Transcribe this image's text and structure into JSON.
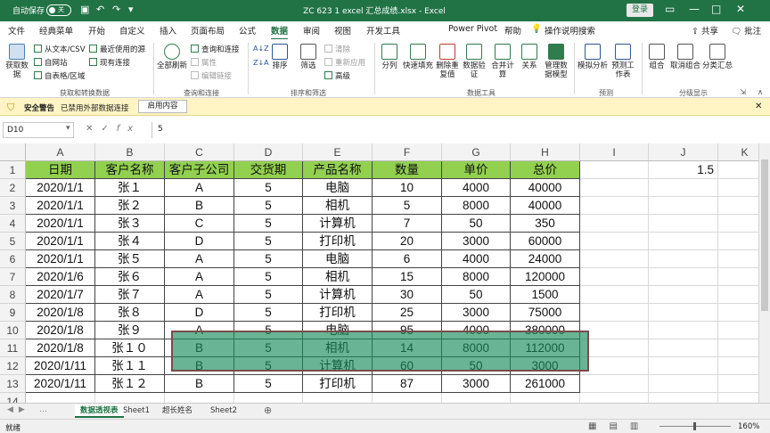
{
  "titlebar": {
    "autosave": "自动保存",
    "toggle": "关",
    "title": "ZC 623 1 excel 汇总成绩.xlsx  -  Excel",
    "login": "登录"
  },
  "tabs": [
    "文件",
    "经典菜单",
    "开始",
    "自定义",
    "插入",
    "页面布局",
    "公式",
    "数据",
    "审阅",
    "视图",
    "开发工具",
    "Power Pivot",
    "帮助",
    "操作说明搜索"
  ],
  "share": "共享",
  "comment": "批注",
  "ribbon": {
    "get_data": "获取数据",
    "from_text": "从文本/CSV",
    "from_web": "自网站",
    "from_table": "自表格/区域",
    "recent": "最近使用的源",
    "existing": "现有连接",
    "refresh_all": "全部刷新",
    "queries": "查询和连接",
    "properties": "属性",
    "edit_links": "编辑链接",
    "sort_az": "A↓Z",
    "sort_za": "Z↓A",
    "sort": "排序",
    "filter": "筛选",
    "clear": "清除",
    "reapply": "重新应用",
    "advanced": "高级",
    "split": "分列",
    "flash": "快速填充",
    "remove_dup": "删除重复值",
    "validate": "数据验证",
    "consolidate": "合并计算",
    "relations": "关系",
    "manage_model": "管理数据模型",
    "whatif": "模拟分析",
    "forecast": "预测工作表",
    "group": "组合",
    "ungroup": "取消组合",
    "subtotal": "分类汇总",
    "groups": [
      "获取和转换数据",
      "查询和连接",
      "排序和筛选",
      "数据工具",
      "预测",
      "分级显示"
    ]
  },
  "security": {
    "title": "安全警告",
    "message": "已禁用外部数据连接",
    "button": "启用内容"
  },
  "formula": {
    "namebox": "D10",
    "cancel": "✕",
    "confirm": "✓",
    "fx": "fx",
    "value": "5"
  },
  "columns": [
    "A",
    "B",
    "C",
    "D",
    "E",
    "F",
    "G",
    "H",
    "I",
    "J",
    "K"
  ],
  "rows": [
    "1",
    "2",
    "3",
    "4",
    "5",
    "6",
    "7",
    "8",
    "9",
    "10",
    "11",
    "12",
    "13",
    "14"
  ],
  "table": [
    [
      "日期",
      "客户名称",
      "客户子公司",
      "交货期",
      "产品名称",
      "数量",
      "单价",
      "总价"
    ],
    [
      "2020/1/1",
      "张１",
      "A",
      "5",
      "电脑",
      "10",
      "4000",
      "40000"
    ],
    [
      "2020/1/1",
      "张２",
      "B",
      "5",
      "相机",
      "5",
      "8000",
      "40000"
    ],
    [
      "2020/1/1",
      "张３",
      "C",
      "5",
      "计算机",
      "7",
      "50",
      "350"
    ],
    [
      "2020/1/1",
      "张４",
      "D",
      "5",
      "打印机",
      "20",
      "3000",
      "60000"
    ],
    [
      "2020/1/1",
      "张５",
      "A",
      "5",
      "电脑",
      "6",
      "4000",
      "24000"
    ],
    [
      "2020/1/6",
      "张６",
      "A",
      "5",
      "相机",
      "15",
      "8000",
      "120000"
    ],
    [
      "2020/1/7",
      "张７",
      "A",
      "5",
      "计算机",
      "30",
      "50",
      "1500"
    ],
    [
      "2020/1/8",
      "张８",
      "D",
      "5",
      "打印机",
      "25",
      "3000",
      "75000"
    ],
    [
      "2020/1/8",
      "张９",
      "A",
      "5",
      "电脑",
      "95",
      "4000",
      "380000"
    ],
    [
      "2020/1/8",
      "张１０",
      "B",
      "5",
      "相机",
      "14",
      "8000",
      "112000"
    ],
    [
      "2020/1/11",
      "张１１",
      "B",
      "5",
      "计算机",
      "60",
      "50",
      "3000"
    ],
    [
      "2020/1/11",
      "张１２",
      "B",
      "5",
      "打印机",
      "87",
      "3000",
      "261000"
    ]
  ],
  "j1": "1.5",
  "sheets": [
    "数据透视表",
    "Sheet1",
    "超长姓名",
    "Sheet2"
  ],
  "status": {
    "ready": "就绪",
    "zoom": "160%"
  }
}
